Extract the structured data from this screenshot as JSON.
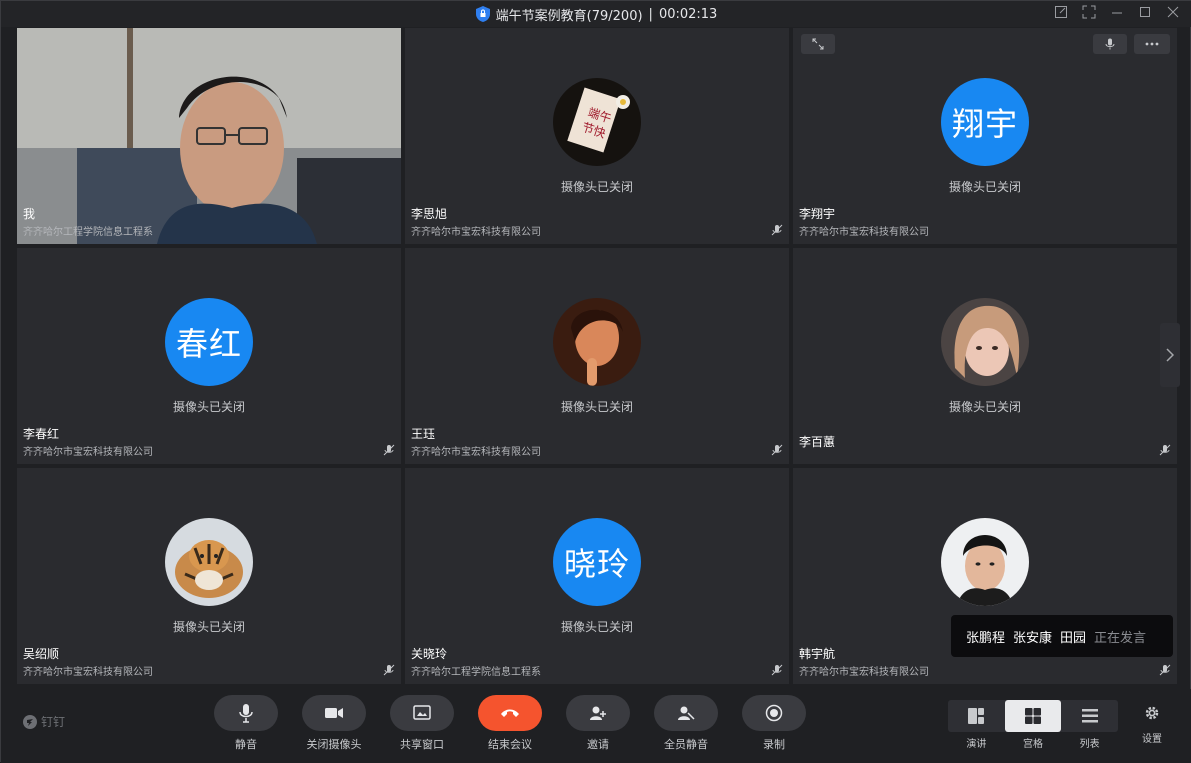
{
  "title": {
    "meeting_name": "端午节案例教育(79/200)",
    "separator": "|",
    "duration": "00:02:13"
  },
  "tiles": [
    {
      "name": "我",
      "org": "齐齐哈尔工程学院信息工程系",
      "type": "video"
    },
    {
      "name": "李思旭",
      "org": "齐齐哈尔市宝宏科技有限公司",
      "type": "photo",
      "status": "摄像头已关闭",
      "muted": true
    },
    {
      "name": "李翔宇",
      "org": "齐齐哈尔市宝宏科技有限公司",
      "type": "text",
      "initials": "翔宇",
      "status": "摄像头已关闭"
    },
    {
      "name": "李春红",
      "org": "齐齐哈尔市宝宏科技有限公司",
      "type": "text",
      "initials": "春红",
      "status": "摄像头已关闭",
      "muted": true
    },
    {
      "name": "王珏",
      "org": "齐齐哈尔市宝宏科技有限公司",
      "type": "photo",
      "status": "摄像头已关闭",
      "muted": true
    },
    {
      "name": "李百蕙",
      "org": "",
      "type": "photo",
      "status": "摄像头已关闭",
      "muted": true
    },
    {
      "name": "吴绍顺",
      "org": "齐齐哈尔市宝宏科技有限公司",
      "type": "photo",
      "status": "摄像头已关闭",
      "muted": true
    },
    {
      "name": "关晓玲",
      "org": "齐齐哈尔工程学院信息工程系",
      "type": "text",
      "initials": "晓玲",
      "status": "摄像头已关闭",
      "muted": true
    },
    {
      "name": "韩宇航",
      "org": "齐齐哈尔市宝宏科技有限公司",
      "type": "photo",
      "status": "",
      "muted": true
    }
  ],
  "speaking": {
    "names": [
      "张鹏程",
      "张安康",
      "田园"
    ],
    "hint": "正在发言"
  },
  "toolbar": {
    "brand": "钉钉",
    "buttons": [
      "静音",
      "关闭摄像头",
      "共享窗口",
      "结束会议",
      "邀请",
      "全员静音",
      "录制"
    ],
    "views": [
      "演讲",
      "宫格",
      "列表"
    ],
    "active_view": "宫格",
    "settings": "设置"
  },
  "colors": {
    "accent_blue": "#1888f2",
    "end_call_red": "#f5542e"
  }
}
